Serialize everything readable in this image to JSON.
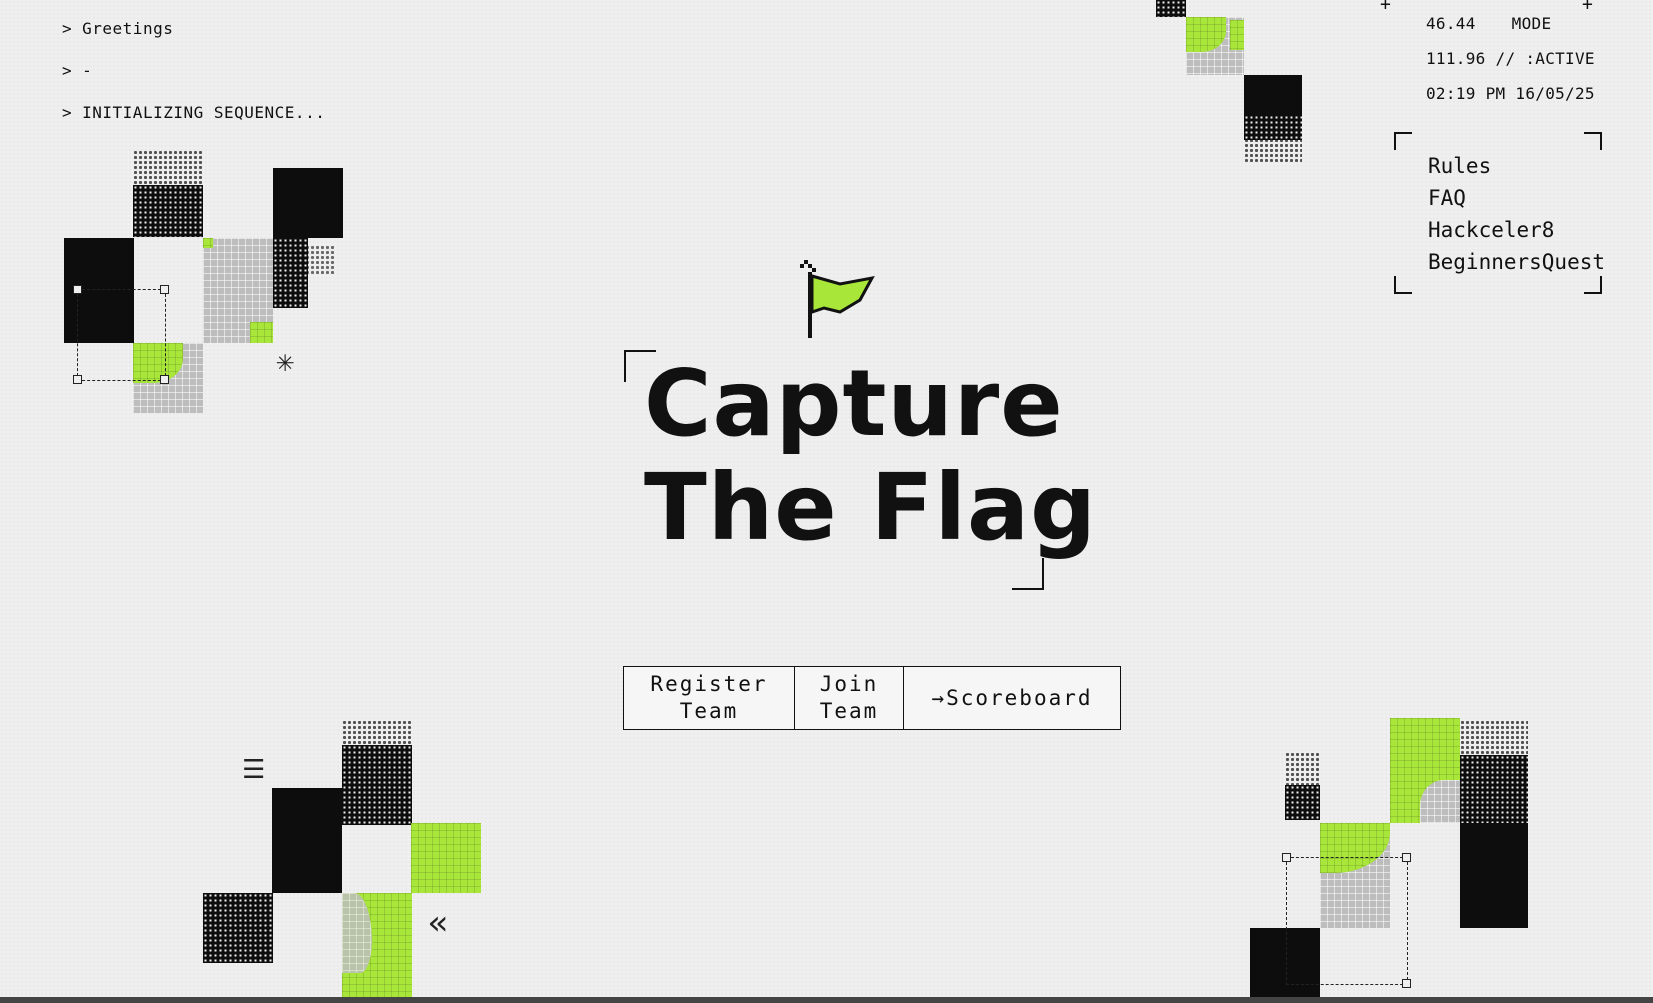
{
  "terminal": {
    "prompt": ">",
    "lines": [
      "Greetings",
      "-",
      "INITIALIZING SEQUENCE..."
    ]
  },
  "status": {
    "plus": "+",
    "value1": "46.44",
    "mode_label": "MODE",
    "value2": "111.96 // :ACTIVE",
    "datetime": "02:19 PM 16/05/25"
  },
  "nav": {
    "items": [
      "Rules",
      "FAQ",
      "Hackceler8",
      "BeginnersQuest"
    ]
  },
  "hero": {
    "title_line1": "Capture",
    "title_line2": "The Flag"
  },
  "actions": {
    "register_line1": "Register",
    "register_line2": "Team",
    "join_line1": "Join",
    "join_line2": "Team",
    "scoreboard": "→Scoreboard"
  },
  "decor": {
    "asterisk": "✳",
    "chevrons": "«",
    "lines_glyph": "☰"
  },
  "colors": {
    "accent_green": "#a8e63a",
    "black": "#0d0d0d",
    "gray": "#bdbdbd",
    "background": "#efefef"
  },
  "icons": {
    "flag": "flag-icon"
  }
}
